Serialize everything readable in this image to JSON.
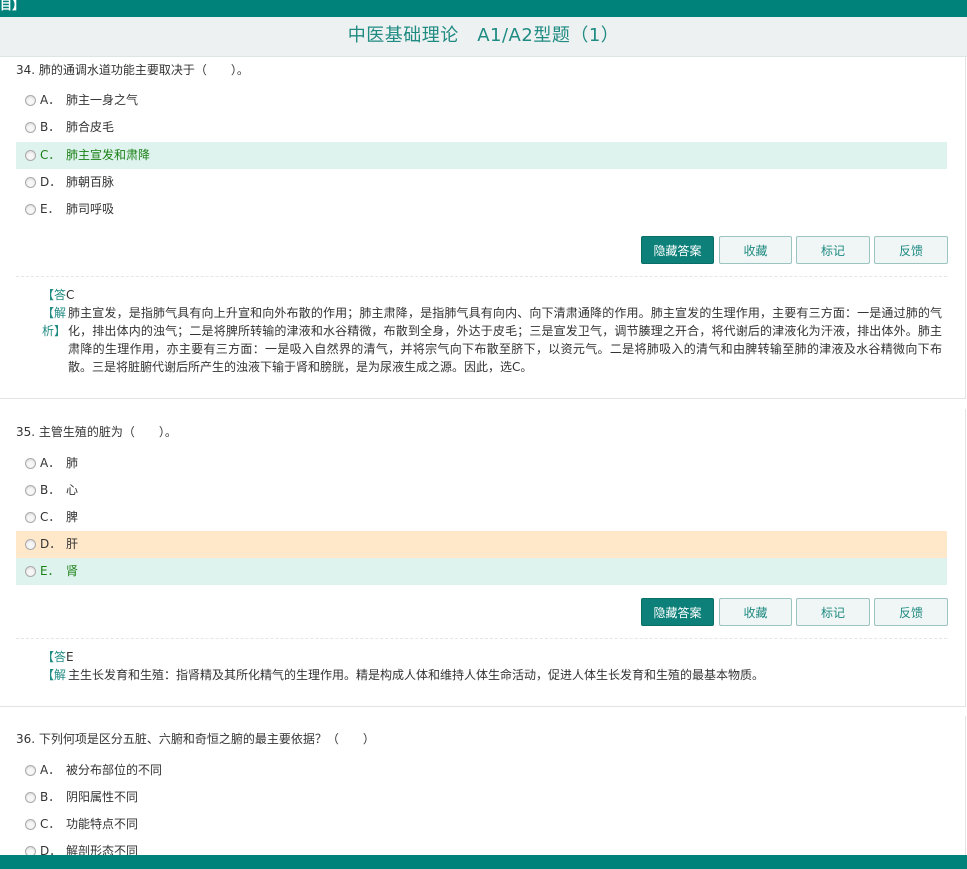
{
  "header": {
    "label": "目】",
    "title": "中医基础理论　A1/A2型题（1）"
  },
  "buttons": {
    "hide_answer": "隐藏答案",
    "collect": "收藏",
    "mark": "标记",
    "feedback": "反馈"
  },
  "labels": {
    "answer_prefix": "【答",
    "analysis_label": "【解析】"
  },
  "questions": [
    {
      "stem": "34. 肺的通调水道功能主要取决于（　　）。",
      "options": [
        {
          "letter": "A．",
          "text": "肺主一身之气"
        },
        {
          "letter": "B．",
          "text": "肺合皮毛"
        },
        {
          "letter": "C．",
          "text": "肺主宣发和肃降"
        },
        {
          "letter": "D．",
          "text": "肺朝百脉"
        },
        {
          "letter": "E．",
          "text": "肺司呼吸"
        }
      ],
      "answer": "C",
      "analysis": "肺主宣发，是指肺气具有向上升宣和向外布散的作用；肺主肃降，是指肺气具有向内、向下清肃通降的作用。肺主宣发的生理作用，主要有三方面：一是通过肺的气化，排出体内的浊气；二是将脾所转输的津液和水谷精微，布散到全身，外达于皮毛；三是宣发卫气，调节腠理之开合，将代谢后的津液化为汗液，排出体外。肺主肃降的生理作用，亦主要有三方面：一是吸入自然界的清气，并将宗气向下布散至脐下，以资元气。二是将肺吸入的清气和由脾转输至肺的津液及水谷精微向下布散。三是将脏腑代谢后所产生的浊液下输于肾和膀胱，是为尿液生成之源。因此，选C。"
    },
    {
      "stem": "35. 主管生殖的脏为（　　）。",
      "options": [
        {
          "letter": "A．",
          "text": "肺"
        },
        {
          "letter": "B．",
          "text": "心"
        },
        {
          "letter": "C．",
          "text": "脾"
        },
        {
          "letter": "D．",
          "text": "肝"
        },
        {
          "letter": "E．",
          "text": "肾"
        }
      ],
      "answer": "E",
      "analysis": "主生长发育和生殖：指肾精及其所化精气的生理作用。精是构成人体和维持人体生命活动，促进人体生长发育和生殖的最基本物质。"
    },
    {
      "stem": "36. 下列何项是区分五脏、六腑和奇恒之腑的最主要依据？（　　）",
      "options": [
        {
          "letter": "A．",
          "text": "被分布部位的不同"
        },
        {
          "letter": "B．",
          "text": "阴阳属性不同"
        },
        {
          "letter": "C．",
          "text": "功能特点不同"
        },
        {
          "letter": "D．",
          "text": "解剖形态不同"
        }
      ]
    }
  ],
  "colors": {
    "brand": "#00827a",
    "correct_bg": "#dff3ee",
    "correct_text": "#1a8016",
    "wrong_bg": "#ffe7c9"
  }
}
